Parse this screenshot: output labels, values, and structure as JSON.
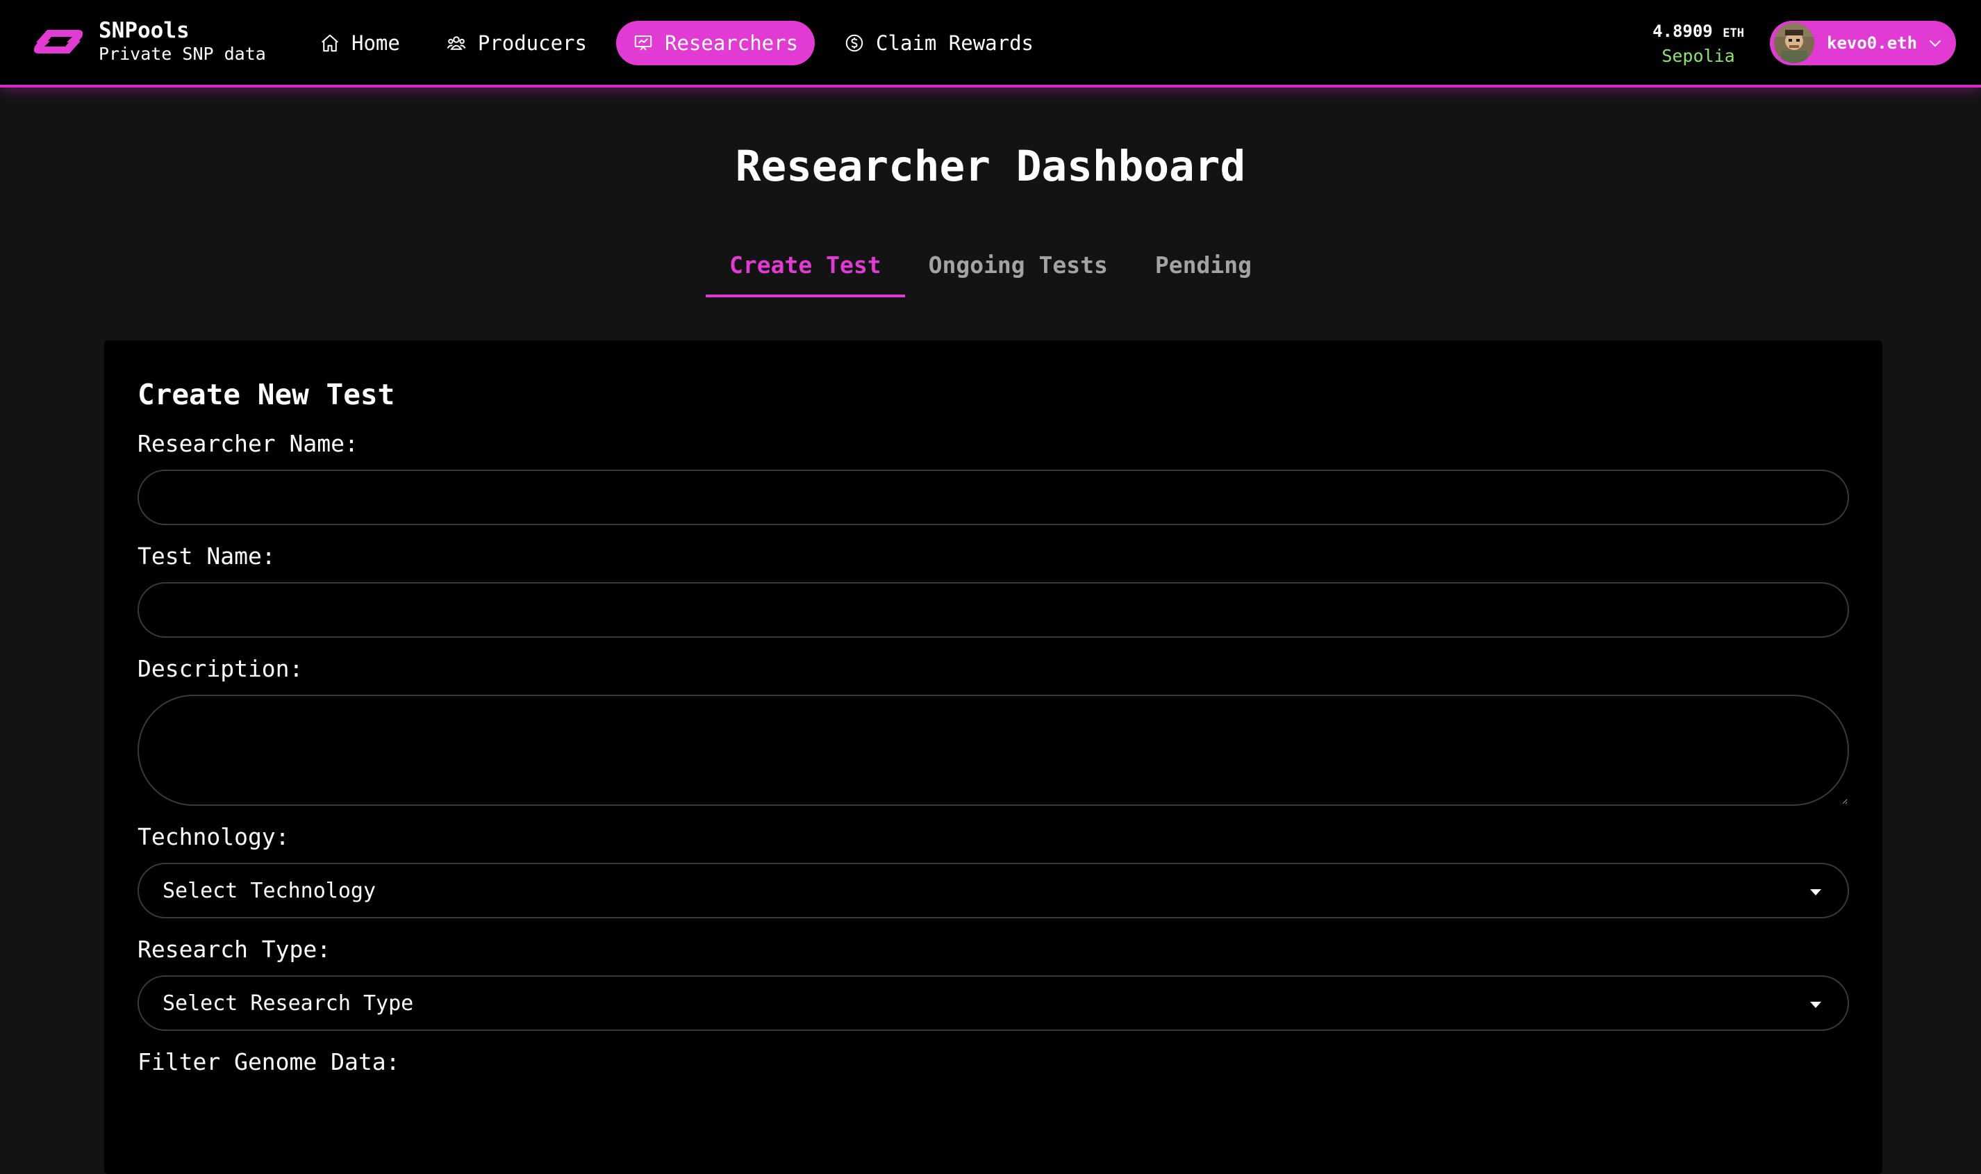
{
  "brand": {
    "name": "SNPools",
    "tagline": "Private SNP data"
  },
  "nav": {
    "items": [
      {
        "label": "Home",
        "icon": "home-icon",
        "active": false
      },
      {
        "label": "Producers",
        "icon": "users-icon",
        "active": false
      },
      {
        "label": "Researchers",
        "icon": "presentation-icon",
        "active": true
      },
      {
        "label": "Claim Rewards",
        "icon": "dollar-coin-icon",
        "active": false
      }
    ]
  },
  "wallet": {
    "balance": "4.8909",
    "unit": "ETH",
    "network": "Sepolia",
    "account": "kevo0.eth"
  },
  "page": {
    "title": "Researcher Dashboard"
  },
  "tabs": [
    {
      "label": "Create Test",
      "active": true
    },
    {
      "label": "Ongoing Tests",
      "active": false
    },
    {
      "label": "Pending",
      "active": false
    }
  ],
  "form": {
    "title": "Create New Test",
    "researcher_name": {
      "label": "Researcher Name:",
      "value": "",
      "placeholder": ""
    },
    "test_name": {
      "label": "Test Name:",
      "value": "",
      "placeholder": ""
    },
    "description": {
      "label": "Description:",
      "value": "",
      "placeholder": ""
    },
    "technology": {
      "label": "Technology:",
      "selected": "Select Technology"
    },
    "research_type": {
      "label": "Research Type:",
      "selected": "Select Research Type"
    },
    "filter_genome": {
      "label": "Filter Genome Data:"
    }
  },
  "colors": {
    "accent": "#e23bd3",
    "background": "#131313",
    "card": "#000000",
    "network": "#8ee36f",
    "tab_inactive": "#a3a3a3"
  }
}
